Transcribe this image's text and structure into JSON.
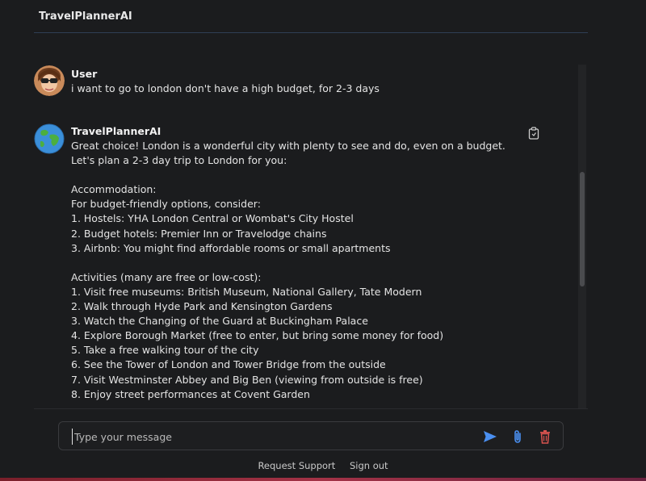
{
  "app": {
    "title": "TravelPlannerAI"
  },
  "messages": [
    {
      "sender": "User",
      "avatar": "user-avatar",
      "text": "i want to go to london don't have a high budget, for 2-3 days"
    },
    {
      "sender": "TravelPlannerAI",
      "avatar": "globe-avatar",
      "text": "Great choice! London is a wonderful city with plenty to see and do, even on a budget. Let's plan a 2-3 day trip to London for you:\n\nAccommodation:\nFor budget-friendly options, consider:\n1. Hostels: YHA London Central or Wombat's City Hostel\n2. Budget hotels: Premier Inn or Travelodge chains\n3. Airbnb: You might find affordable rooms or small apartments\n\nActivities (many are free or low-cost):\n1. Visit free museums: British Museum, National Gallery, Tate Modern\n2. Walk through Hyde Park and Kensington Gardens\n3. Watch the Changing of the Guard at Buckingham Palace\n4. Explore Borough Market (free to enter, but bring some money for food)\n5. Take a free walking tour of the city\n6. See the Tower of London and Tower Bridge from the outside\n7. Visit Westminster Abbey and Big Ben (viewing from outside is free)\n8. Enjoy street performances at Covent Garden",
      "copy_icon": "copy-clipboard-icon"
    }
  ],
  "input": {
    "placeholder": "Type your message",
    "value": ""
  },
  "actions": {
    "send_icon": "send-icon",
    "attach_icon": "paperclip-icon",
    "delete_icon": "trash-icon"
  },
  "footer": {
    "support_label": "Request Support",
    "signout_label": "Sign out"
  },
  "colors": {
    "send": "#4a8ff0",
    "attach": "#4a8ff0",
    "delete": "#d9534f",
    "background": "#1b1c1e"
  }
}
